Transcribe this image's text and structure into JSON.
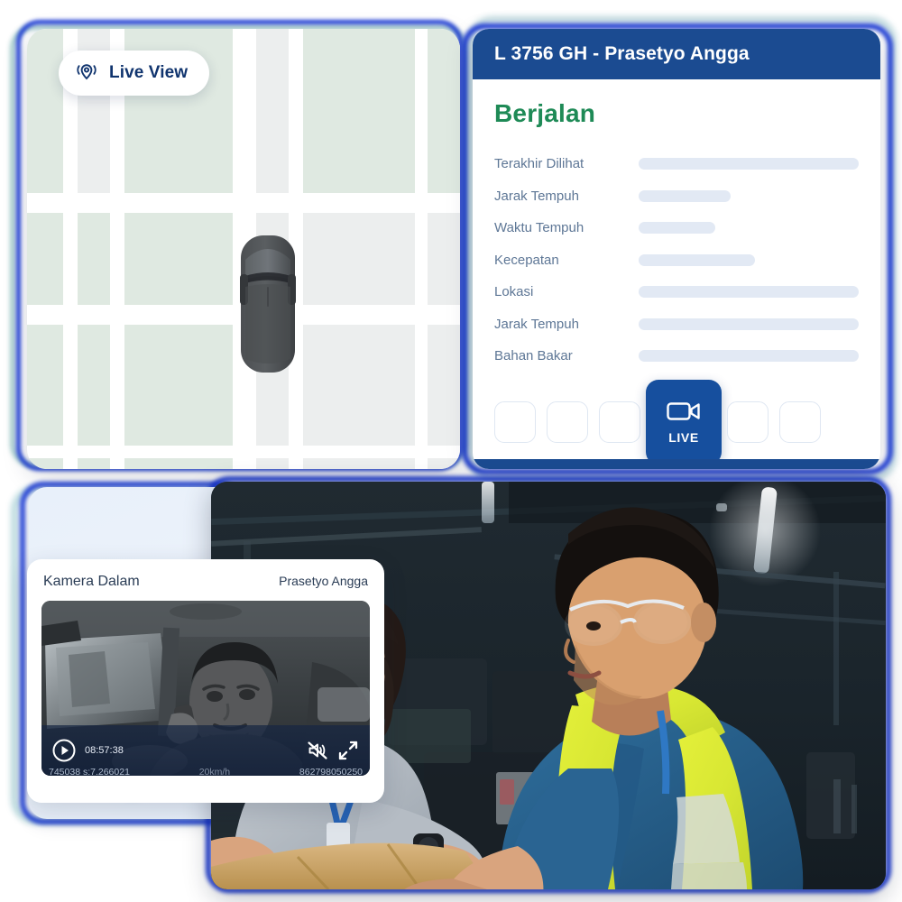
{
  "map_card": {
    "live_view": {
      "label": "Live View",
      "icon": "location-pin-signal-icon"
    },
    "vehicle_marker_icon": "car-top-view-icon"
  },
  "detail_panel": {
    "header_title": "L 3756 GH - Prasetyo Angga",
    "status": "Berjalan",
    "status_color": "#1e8a56",
    "header_color": "#1b4b91",
    "rows": [
      {
        "label": "Terakhir Dilihat",
        "skeleton_width": "100%"
      },
      {
        "label": "Jarak Tempuh",
        "skeleton_width": "42%"
      },
      {
        "label": "Waktu Tempuh",
        "skeleton_width": "35%"
      },
      {
        "label": "Kecepatan",
        "skeleton_width": "53%"
      },
      {
        "label": "Lokasi",
        "skeleton_width": "100%"
      },
      {
        "label": "Jarak Tempuh",
        "skeleton_width": "100%"
      },
      {
        "label": "Bahan Bakar",
        "skeleton_width": "100%"
      }
    ],
    "actions": {
      "live_button": {
        "label": "LIVE",
        "icon": "video-camera-icon",
        "active": true,
        "active_color": "#164f9e"
      },
      "placeholder_count_left": 3,
      "placeholder_count_right": 2
    }
  },
  "camera_card": {
    "title": "Kamera Dalam",
    "driver": "Prasetyo Angga",
    "video": {
      "play_icon": "play-circle-icon",
      "timestamp": "08:57:38",
      "mute_icon": "speaker-muted-icon",
      "fullscreen_icon": "expand-arrows-icon",
      "overlay_left": "745038   s:7.266021",
      "overlay_mid": "20km/h",
      "overlay_right": "862798050250"
    }
  },
  "photo_card": {
    "alt": "two warehouse workers reviewing a package"
  }
}
